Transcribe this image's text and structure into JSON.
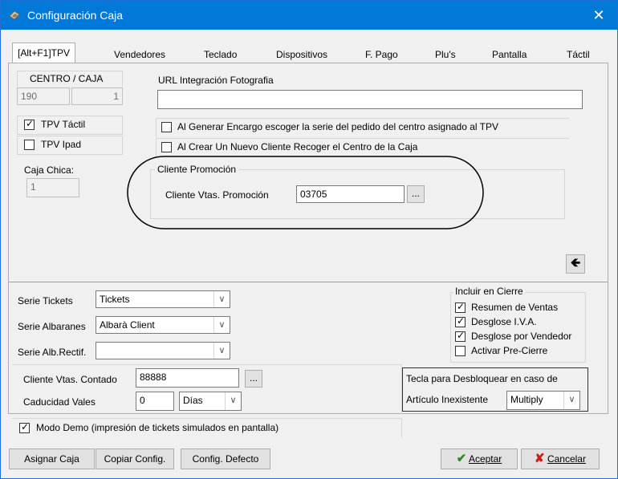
{
  "window": {
    "title": "Configuración Caja",
    "close": "✕"
  },
  "tabs": [
    "[Alt+F1]TPV",
    "Vendedores",
    "Teclado",
    "Dispositivos",
    "F. Pago",
    "Plu's",
    "Pantalla",
    "Táctil"
  ],
  "centro": {
    "label": "CENTRO / CAJA",
    "centro_value": "190",
    "caja_value": "1"
  },
  "url": {
    "label": "URL Integración Fotografia",
    "value": ""
  },
  "checks_left": {
    "tpv_tactil": "TPV Táctil",
    "tpv_ipad": "TPV Ipad"
  },
  "checks_right": {
    "encargo": "Al Generar Encargo escoger la serie del pedido del centro asignado al TPV",
    "nuevo_cliente": "Al Crear Un Nuevo Cliente Recoger el Centro de la Caja"
  },
  "caja_chica": {
    "label": "Caja Chica:",
    "value": "1"
  },
  "promocion": {
    "group": "Cliente Promoción",
    "label": "Cliente Vtas. Promoción",
    "value": "03705",
    "browse": "..."
  },
  "series": {
    "tickets_label": "Serie Tickets",
    "tickets_value": "Tickets",
    "albaranes_label": "Serie Albaranes",
    "albaranes_value": "Albarà Client",
    "rectif_label": "Serie Alb.Rectif.",
    "rectif_value": ""
  },
  "contado": {
    "label": "Cliente Vtas. Contado",
    "value": "88888",
    "browse": "..."
  },
  "caducidad": {
    "label": "Caducidad Vales",
    "value": "0",
    "unit": "Días"
  },
  "cierre": {
    "group": "Incluir en Cierre",
    "items": [
      "Resumen de Ventas",
      "Desglose I.V.A.",
      "Desglose por Vendedor",
      "Activar Pre-Cierre"
    ]
  },
  "tecla": {
    "line1": "Tecla para Desbloquear en caso de",
    "line2": "Artículo Inexistente",
    "value": "Multiply"
  },
  "demo": "Modo Demo (impresión de tickets simulados en pantalla)",
  "buttons": {
    "asignar": "Asignar Caja",
    "copiar": "Copiar Config.",
    "defecto": "Config. Defecto",
    "aceptar": "Aceptar",
    "cancelar": "Cancelar"
  },
  "colors": {
    "titlebar": "#0078d7",
    "accept_check": "#2e8b22",
    "cancel_x": "#c81e1e"
  }
}
